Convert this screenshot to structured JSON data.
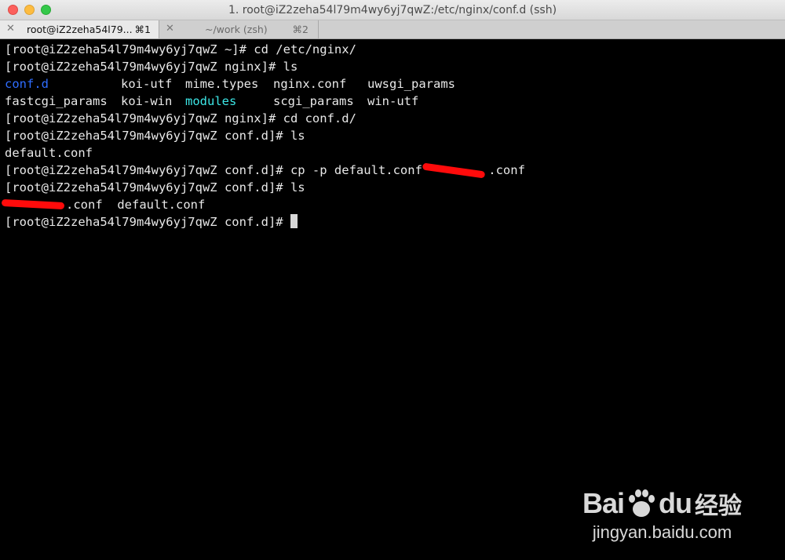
{
  "window": {
    "title": "1. root@iZ2zeha54l79m4wy6yj7qwZ:/etc/nginx/conf.d (ssh)",
    "tabs": [
      {
        "label": "root@iZ2zeha54l79...",
        "shortcut": "⌘1"
      },
      {
        "label": "~/work (zsh)",
        "shortcut": "⌘2"
      }
    ],
    "close_glyph": "✕"
  },
  "terminal": {
    "l1": "[root@iZ2zeha54l79m4wy6yj7qwZ ~]# cd /etc/nginx/",
    "l2": "[root@iZ2zeha54l79m4wy6yj7qwZ nginx]# ls",
    "ls1": {
      "row1": [
        "conf.d",
        "koi-utf",
        "mime.types",
        "nginx.conf",
        "uwsgi_params"
      ],
      "row2": [
        "fastcgi_params",
        "koi-win",
        "modules",
        "scgi_params",
        "win-utf"
      ]
    },
    "l5": "[root@iZ2zeha54l79m4wy6yj7qwZ nginx]# cd conf.d/",
    "l6": "[root@iZ2zeha54l79m4wy6yj7qwZ conf.d]# ls",
    "l7": "default.conf",
    "l8": "[root@iZ2zeha54l79m4wy6yj7qwZ conf.d]# cp -p default.conf ",
    "l8_tail_visible": ".conf",
    "l9": "[root@iZ2zeha54l79m4wy6yj7qwZ conf.d]# ls",
    "l10_a_visible": ".conf",
    "l10_b": "default.conf",
    "l11": "[root@iZ2zeha54l79m4wy6yj7qwZ conf.d]# "
  },
  "colors": {
    "directory": "#2f6dff",
    "executable_dir": "#3ce6e6",
    "redaction": "#ff0b0b"
  },
  "watermark": {
    "brand": "Bai",
    "brand2": "du",
    "cn": "经验",
    "url": "jingyan.baidu.com"
  }
}
